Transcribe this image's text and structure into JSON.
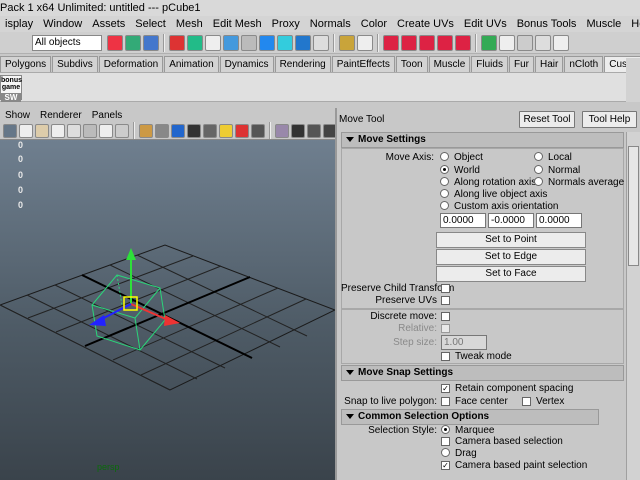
{
  "window": {
    "title": "Pack 1 x64 Unlimited: untitled   ---   pCube1"
  },
  "menubar": [
    "isplay",
    "Window",
    "Assets",
    "Select",
    "Mesh",
    "Edit Mesh",
    "Proxy",
    "Normals",
    "Color",
    "Create UVs",
    "Edit UVs",
    "Bonus Tools",
    "Muscle",
    "Help"
  ],
  "status_line": {
    "selection_mode": "All objects"
  },
  "shelf_tabs": [
    "Polygons",
    "Subdivs",
    "Deformation",
    "Animation",
    "Dynamics",
    "Rendering",
    "PaintEffects",
    "Toon",
    "Muscle",
    "Fluids",
    "Fur",
    "Hair",
    "nCloth",
    "Custom"
  ],
  "shelf_active_tab": "Custom",
  "shelf": {
    "badge_line1": "bonus",
    "badge_line2": "game",
    "badge_line3": "SW"
  },
  "viewport": {
    "menus": [
      "Show",
      "Renderer",
      "Panels"
    ],
    "hud_values": [
      "0",
      "0",
      "0",
      "0",
      "0"
    ],
    "camera_label": "persp"
  },
  "tool_settings": {
    "title": "Move Tool",
    "reset_button": "Reset Tool",
    "help_button": "Tool Help",
    "move_settings": {
      "header": "Move Settings",
      "move_axis_label": "Move Axis:",
      "axis_options": [
        {
          "label": "Object",
          "selected": false
        },
        {
          "label": "Local",
          "selected": false
        },
        {
          "label": "World",
          "selected": true
        },
        {
          "label": "Normal",
          "selected": false
        },
        {
          "label": "Along rotation axis",
          "selected": false
        },
        {
          "label": "Normals average",
          "selected": false
        },
        {
          "label": "Along live object axis",
          "selected": false
        },
        {
          "label": "Custom axis orientation",
          "selected": false
        }
      ],
      "custom_axis_values": [
        "0.0000",
        "-0.0000",
        "0.0000"
      ],
      "set_to_point": "Set to Point",
      "set_to_edge": "Set to Edge",
      "set_to_face": "Set to Face",
      "preserve_child_transform": "Preserve Child Transform",
      "preserve_uvs": "Preserve UVs",
      "discrete_move": "Discrete move:",
      "relative": "Relative:",
      "step_size_label": "Step size:",
      "step_size_value": "1.00",
      "tweak_mode": "Tweak mode"
    },
    "move_snap_settings": {
      "header": "Move Snap Settings",
      "retain_component_spacing": "Retain component spacing",
      "snap_to_live_polygon": "Snap to live polygon:",
      "face_center": "Face center",
      "vertex": "Vertex"
    },
    "common_selection_options": {
      "header": "Common Selection Options",
      "selection_style_label": "Selection Style:",
      "marquee": "Marquee",
      "camera_based_selection": "Camera based selection",
      "drag": "Drag",
      "camera_based_paint_selection": "Camera based paint selection"
    }
  }
}
